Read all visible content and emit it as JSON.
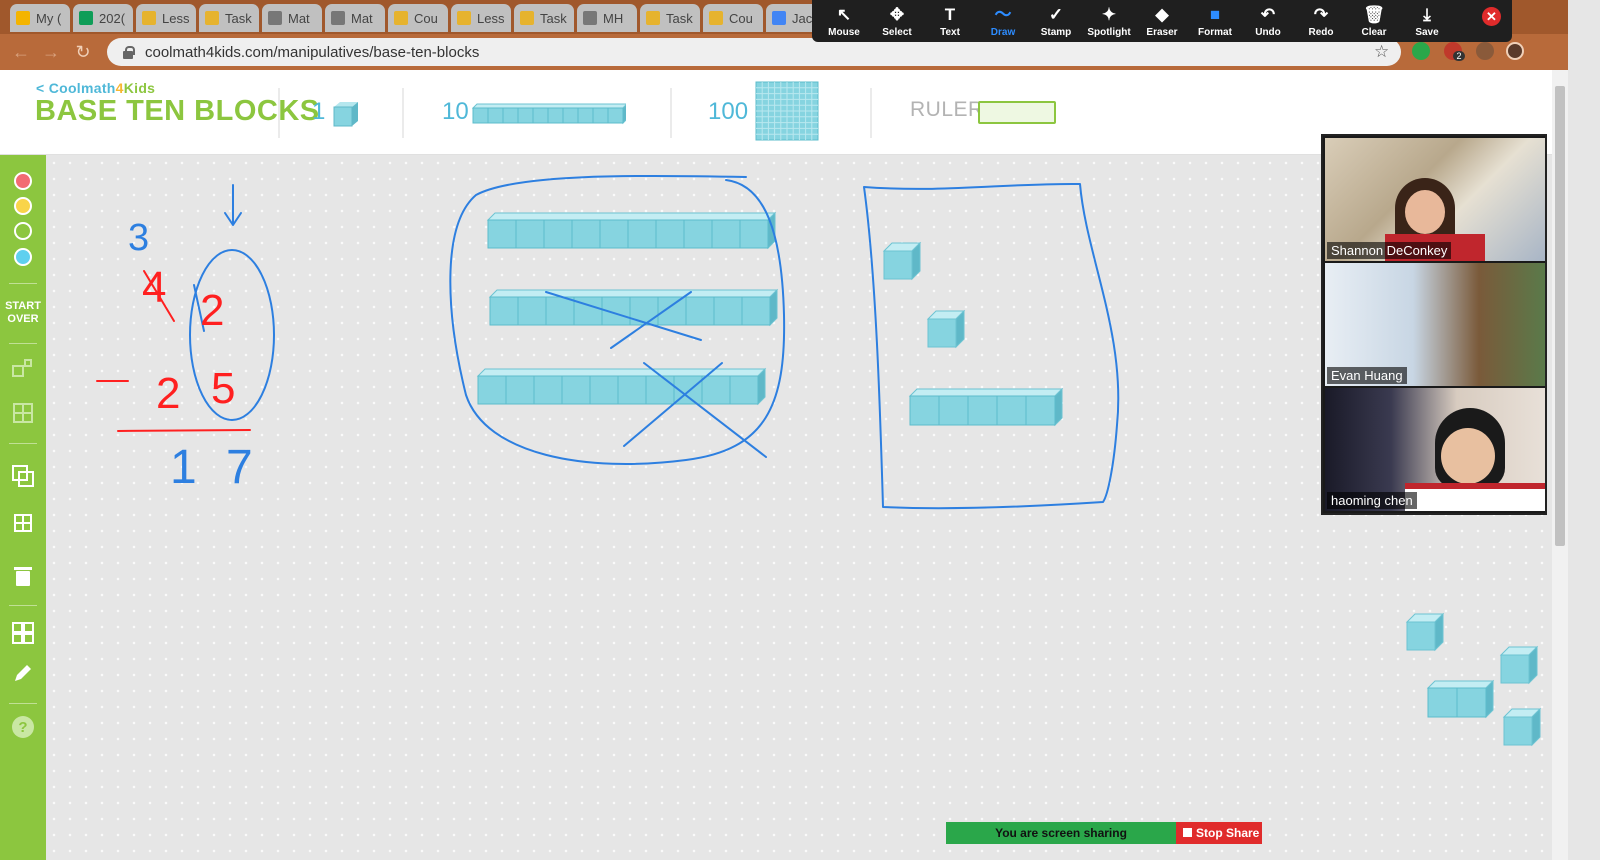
{
  "browser": {
    "tabs": [
      {
        "label": "My (",
        "icon": "google-drive-icon",
        "color": "#f4b400"
      },
      {
        "label": "202(",
        "icon": "sheets-icon",
        "color": "#0f9d58"
      },
      {
        "label": "Less",
        "icon": "doc-icon",
        "color": "#e6b32e"
      },
      {
        "label": "Task",
        "icon": "doc-icon",
        "color": "#e6b32e"
      },
      {
        "label": "Mat",
        "icon": "globe-icon",
        "color": "#777777"
      },
      {
        "label": "Mat",
        "icon": "globe-icon",
        "color": "#777777"
      },
      {
        "label": "Cou",
        "icon": "doc-icon",
        "color": "#e6b32e"
      },
      {
        "label": "Less",
        "icon": "doc-icon",
        "color": "#e6b32e"
      },
      {
        "label": "Task",
        "icon": "doc-icon",
        "color": "#e6b32e"
      },
      {
        "label": "MH",
        "icon": "globe-icon",
        "color": "#777777"
      },
      {
        "label": "Task",
        "icon": "doc-icon",
        "color": "#e6b32e"
      },
      {
        "label": "Cou",
        "icon": "doc-icon",
        "color": "#e6b32e"
      },
      {
        "label": "Jaco",
        "icon": "google-docs-icon",
        "color": "#4285f4"
      }
    ],
    "url": "coolmath4kids.com/manipulatives/base-ten-blocks",
    "extension_badge": "2"
  },
  "zoom_toolbar": {
    "tools": [
      {
        "label": "Mouse",
        "icon": "cursor-icon",
        "glyph": "↖"
      },
      {
        "label": "Select",
        "icon": "move-icon",
        "glyph": "✥"
      },
      {
        "label": "Text",
        "icon": "text-icon",
        "glyph": "T"
      },
      {
        "label": "Draw",
        "icon": "draw-icon",
        "glyph": "〜",
        "active": true
      },
      {
        "label": "Stamp",
        "icon": "checkmark-icon",
        "glyph": "✓"
      },
      {
        "label": "Spotlight",
        "icon": "spotlight-icon",
        "glyph": "✦"
      },
      {
        "label": "Eraser",
        "icon": "eraser-icon",
        "glyph": "◆"
      },
      {
        "label": "Format",
        "icon": "format-icon",
        "glyph": "■"
      },
      {
        "label": "Undo",
        "icon": "undo-icon",
        "glyph": "↶"
      },
      {
        "label": "Redo",
        "icon": "redo-icon",
        "glyph": "↷"
      },
      {
        "label": "Clear",
        "icon": "trash-icon",
        "glyph": "🗑"
      },
      {
        "label": "Save",
        "icon": "save-icon",
        "glyph": "⤓"
      }
    ],
    "close_glyph": "✕"
  },
  "app": {
    "back_link": {
      "part1": "Coolmath",
      "part2": "4",
      "part3": "Kids",
      "prefix": "<"
    },
    "title": "BASE TEN BLOCKS",
    "palette": {
      "one_label": "1",
      "ten_label": "10",
      "hundred_label": "100",
      "ruler_label": "RULER"
    },
    "sidebar": {
      "colors": [
        "#f26b73",
        "#f9d44a",
        "#8cc63f",
        "#5fd0ef"
      ],
      "start_over_line1": "START",
      "start_over_line2": "OVER"
    },
    "accent_green": "#8cc63f",
    "accent_blue": "#4fb8d8",
    "block_color": "#86d4e0"
  },
  "whiteboard": {
    "annotations": [
      "3",
      "4",
      "2",
      "−",
      "2",
      "5",
      "1",
      "7"
    ]
  },
  "participants": [
    {
      "name": "Shannon DeConkey"
    },
    {
      "name": "Evan Huang"
    },
    {
      "name": "haoming chen"
    }
  ],
  "share_bar": {
    "status": "You are screen sharing",
    "stop_label": "Stop Share"
  }
}
